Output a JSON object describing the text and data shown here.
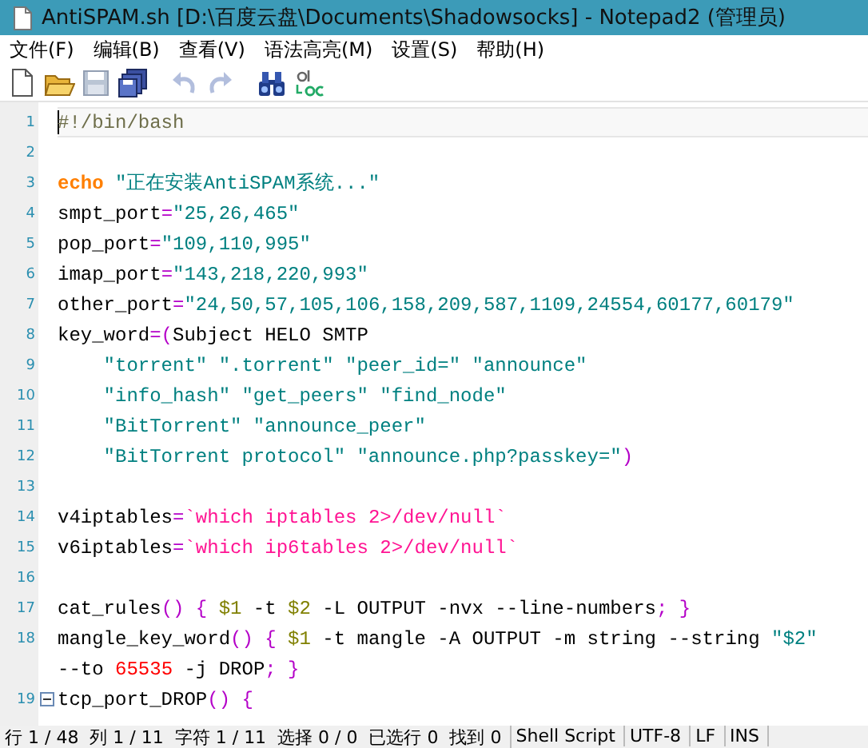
{
  "window": {
    "title": "AntiSPAM.sh [D:\\百度云盘\\Documents\\Shadowsocks] - Notepad2 (管理员)"
  },
  "menu": [
    "文件(F)",
    "编辑(B)",
    "查看(V)",
    "语法高亮(M)",
    "设置(S)",
    "帮助(H)"
  ],
  "toolbar": [
    {
      "kind": "document",
      "disabled": false
    },
    {
      "kind": "folder",
      "disabled": false
    },
    {
      "kind": "disk",
      "disabled": true
    },
    {
      "kind": "disks",
      "disabled": false
    },
    {
      "kind": "separator"
    },
    {
      "kind": "undo",
      "disabled": true
    },
    {
      "kind": "redo",
      "disabled": true
    },
    {
      "kind": "separator"
    },
    {
      "kind": "binoculars",
      "disabled": false
    },
    {
      "kind": "replace",
      "disabled": false
    }
  ],
  "editor": {
    "lines": [
      {
        "number": "1",
        "current": true,
        "tokens": [
          {
            "kind": "comment",
            "text": "#!/bin/bash"
          }
        ]
      },
      {
        "number": "2"
      },
      {
        "number": "3",
        "tokens": [
          {
            "kind": "keyword",
            "text": "echo"
          },
          {
            "kind": "string",
            "text": " \"正在安装AntiSPAM系统...\""
          }
        ]
      },
      {
        "number": "4",
        "tokens": [
          {
            "kind": "plain",
            "text": "smpt_port"
          },
          {
            "kind": "operator",
            "text": "="
          },
          {
            "kind": "string",
            "text": "\"25,26,465\""
          }
        ]
      },
      {
        "number": "5",
        "tokens": [
          {
            "kind": "plain",
            "text": "pop_port"
          },
          {
            "kind": "operator",
            "text": "="
          },
          {
            "kind": "string",
            "text": "\"109,110,995\""
          }
        ]
      },
      {
        "number": "6",
        "tokens": [
          {
            "kind": "plain",
            "text": "imap_port"
          },
          {
            "kind": "operator",
            "text": "="
          },
          {
            "kind": "string",
            "text": "\"143,218,220,993\""
          }
        ]
      },
      {
        "number": "7",
        "tokens": [
          {
            "kind": "plain",
            "text": "other_port"
          },
          {
            "kind": "operator",
            "text": "="
          },
          {
            "kind": "string",
            "text": "\"24,50,57,105,106,158,209,587,1109,24554,60177,60179\""
          }
        ]
      },
      {
        "number": "8",
        "tokens": [
          {
            "kind": "plain",
            "text": "key_word"
          },
          {
            "kind": "operator",
            "text": "=("
          },
          {
            "kind": "plain",
            "text": "Subject HELO SMTP"
          }
        ]
      },
      {
        "number": "9",
        "tokens": [
          {
            "kind": "string",
            "text": "    \"torrent\" \".torrent\" \"peer_id=\" \"announce\""
          }
        ]
      },
      {
        "number": "10",
        "tokens": [
          {
            "kind": "string",
            "text": "    \"info_hash\" \"get_peers\" \"find_node\""
          }
        ]
      },
      {
        "number": "11",
        "tokens": [
          {
            "kind": "string",
            "text": "    \"BitTorrent\" \"announce_peer\""
          }
        ]
      },
      {
        "number": "12",
        "tokens": [
          {
            "kind": "string",
            "text": "    \"BitTorrent protocol\" \"announce.php?passkey=\""
          },
          {
            "kind": "operator",
            "text": ")"
          }
        ]
      },
      {
        "number": "13"
      },
      {
        "number": "14",
        "tokens": [
          {
            "kind": "plain",
            "text": "v4iptables"
          },
          {
            "kind": "operator",
            "text": "="
          },
          {
            "kind": "backtick",
            "text": "`which iptables 2>/dev/null`"
          }
        ]
      },
      {
        "number": "15",
        "tokens": [
          {
            "kind": "plain",
            "text": "v6iptables"
          },
          {
            "kind": "operator",
            "text": "="
          },
          {
            "kind": "backtick",
            "text": "`which ip6tables 2>/dev/null`"
          }
        ]
      },
      {
        "number": "16"
      },
      {
        "number": "17",
        "tokens": [
          {
            "kind": "plain",
            "text": "cat_rules"
          },
          {
            "kind": "operator",
            "text": "() {"
          },
          {
            "kind": "variable",
            "text": " $1"
          },
          {
            "kind": "plain",
            "text": " -t "
          },
          {
            "kind": "variable",
            "text": "$2"
          },
          {
            "kind": "plain",
            "text": " -L OUTPUT -nvx --line-numbers"
          },
          {
            "kind": "operator",
            "text": "; }"
          }
        ]
      },
      {
        "number": "18",
        "tokens": [
          {
            "kind": "plain",
            "text": "mangle_key_word"
          },
          {
            "kind": "operator",
            "text": "() {"
          },
          {
            "kind": "variable",
            "text": " $1"
          },
          {
            "kind": "plain",
            "text": " -t mangle -A OUTPUT -m string --string "
          },
          {
            "kind": "string",
            "text": "\"$2\""
          }
        ]
      },
      {
        "tokens": [
          {
            "kind": "plain",
            "text": "--to "
          },
          {
            "kind": "number",
            "text": "65535"
          },
          {
            "kind": "plain",
            "text": " -j DROP"
          },
          {
            "kind": "operator",
            "text": "; }"
          }
        ]
      },
      {
        "number": "19",
        "fold": true,
        "tokens": [
          {
            "kind": "plain",
            "text": "tcp_port_DROP"
          },
          {
            "kind": "operator",
            "text": "() {"
          }
        ]
      }
    ]
  },
  "status_bar": [
    "行 1 / 48  列 1 / 11  字符 1 / 11  选择 0 / 0  已选行 0  找到 0",
    "Shell Script",
    "UTF-8",
    "LF",
    "INS"
  ]
}
